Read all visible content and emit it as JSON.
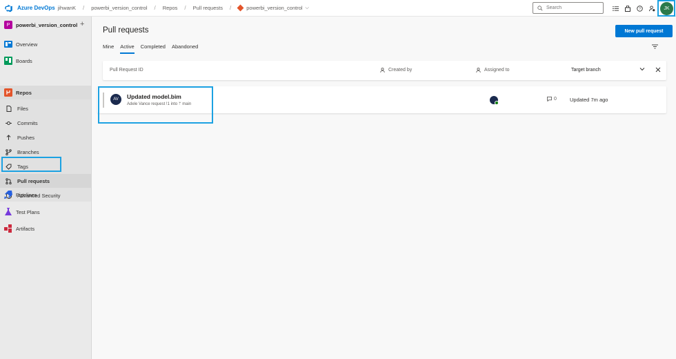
{
  "topbar": {
    "brand": "Azure DevOps",
    "org": "jihwanK",
    "breadcrumbs": [
      "powerbi_version_control",
      "Repos",
      "Pull requests"
    ],
    "repo": "powerbi_version_control",
    "search_placeholder": "Search",
    "user_initials": "JK"
  },
  "sidebar": {
    "project_initial": "P",
    "project_name": "powerbi_version_control",
    "items": {
      "overview": "Overview",
      "boards": "Boards",
      "repos": "Repos",
      "files": "Files",
      "commits": "Commits",
      "pushes": "Pushes",
      "branches": "Branches",
      "tags": "Tags",
      "pull_requests": "Pull requests",
      "advanced_security": "Advanced Security",
      "pipelines": "Pipelines",
      "test_plans": "Test Plans",
      "artifacts": "Artifacts"
    }
  },
  "main": {
    "title": "Pull requests",
    "new_pr_label": "New pull request",
    "tabs": {
      "mine": "Mine",
      "active": "Active",
      "completed": "Completed",
      "abandoned": "Abandoned"
    },
    "columns": {
      "id": "Pull Request ID",
      "created_by": "Created by",
      "assigned_to": "Assigned to",
      "target_branch": "Target branch"
    },
    "pr": {
      "avatar_initials": "AV",
      "title": "Updated model.bim",
      "subtitle": "Adele Vance request !1 into ᛘ main",
      "comments": "0",
      "updated": "Updated 7m ago"
    }
  },
  "colors": {
    "accent": "#0078d4",
    "highlight": "#1ba1e2",
    "project": "#b4009e"
  }
}
